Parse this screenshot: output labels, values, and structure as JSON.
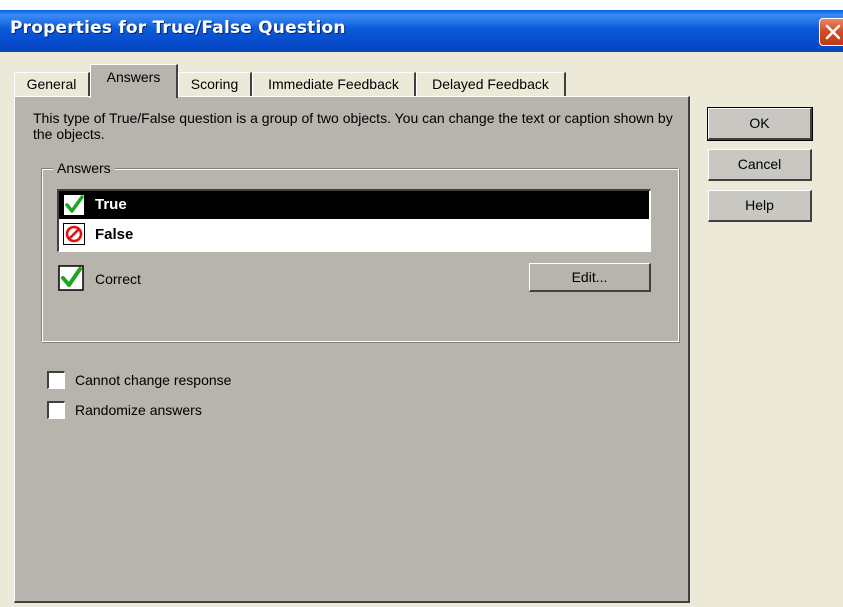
{
  "window": {
    "title": "Properties for True/False Question",
    "accent": "#0a5fe0",
    "close_color": "#d04a24"
  },
  "tabs": [
    {
      "label": "General",
      "active": false
    },
    {
      "label": "Answers",
      "active": true
    },
    {
      "label": "Scoring",
      "active": false
    },
    {
      "label": "Immediate Feedback",
      "active": false
    },
    {
      "label": "Delayed Feedback",
      "active": false
    }
  ],
  "panel": {
    "description": "This type of True/False question is a group of two objects.  You can change the text or caption shown by the objects.",
    "answers_group": {
      "legend": "Answers",
      "items": [
        {
          "label": "True",
          "icon": "green-check-icon",
          "selected": true
        },
        {
          "label": "False",
          "icon": "red-no-icon",
          "selected": false
        }
      ],
      "correct_label": "Correct",
      "edit_label": "Edit..."
    },
    "options": {
      "cannot_change_label": "Cannot change response",
      "cannot_change_checked": false,
      "randomize_label": "Randomize answers",
      "randomize_checked": false
    }
  },
  "buttons": {
    "ok": "OK",
    "cancel": "Cancel",
    "help": "Help"
  }
}
